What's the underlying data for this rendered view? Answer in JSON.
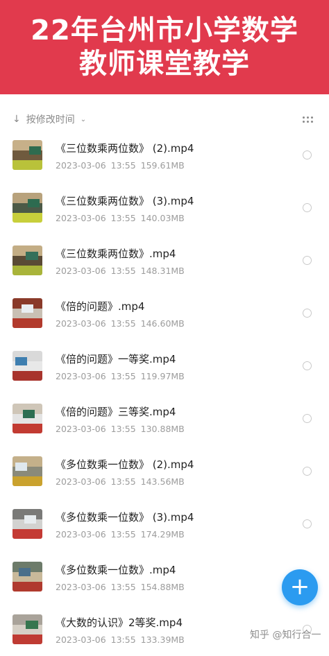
{
  "banner": {
    "line1": "22年台州市小学数学",
    "line2": "教师课堂教学",
    "bg_color": "#e13a4d"
  },
  "sortbar": {
    "arrow_icon": "↓",
    "sort_label": "按修改时间",
    "chevron_icon": "⌄",
    "view_icon": "grid-icon"
  },
  "files": [
    {
      "name": "《三位数乘两位数》 (2).mp4",
      "date": "2023-03-06",
      "time": "13:55",
      "size": "159.61MB"
    },
    {
      "name": "《三位数乘两位数》 (3).mp4",
      "date": "2023-03-06",
      "time": "13:55",
      "size": "140.03MB"
    },
    {
      "name": "《三位数乘两位数》.mp4",
      "date": "2023-03-06",
      "time": "13:55",
      "size": "148.31MB"
    },
    {
      "name": "《倍的问题》.mp4",
      "date": "2023-03-06",
      "time": "13:55",
      "size": "146.60MB"
    },
    {
      "name": "《倍的问题》一等奖.mp4",
      "date": "2023-03-06",
      "time": "13:55",
      "size": "119.97MB"
    },
    {
      "name": "《倍的问题》三等奖.mp4",
      "date": "2023-03-06",
      "time": "13:55",
      "size": "130.88MB"
    },
    {
      "name": "《多位数乘一位数》 (2).mp4",
      "date": "2023-03-06",
      "time": "13:55",
      "size": "143.56MB"
    },
    {
      "name": "《多位数乘一位数》 (3).mp4",
      "date": "2023-03-06",
      "time": "13:55",
      "size": "174.29MB"
    },
    {
      "name": "《多位数乘一位数》.mp4",
      "date": "2023-03-06",
      "time": "13:55",
      "size": "154.88MB"
    },
    {
      "name": "《大数的认识》2等奖.mp4",
      "date": "2023-03-06",
      "time": "13:55",
      "size": "133.39MB"
    }
  ],
  "fab": {
    "icon": "+",
    "color": "#2b9bf0"
  },
  "watermark": "知乎 @知行合一"
}
